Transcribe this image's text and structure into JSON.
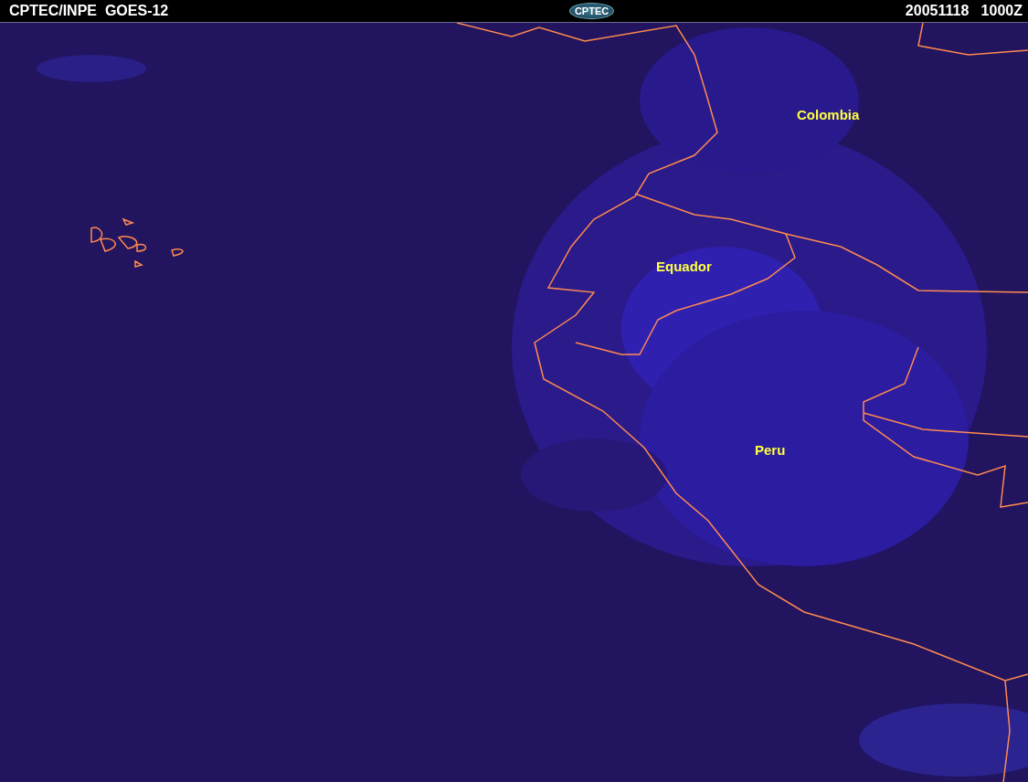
{
  "header": {
    "title": "CPTEC/INPE  GOES-12",
    "logo": "CPTEC",
    "timestamp": "20051118   1000Z"
  },
  "map": {
    "labels": [
      {
        "text": "Colombia"
      },
      {
        "text": "Equador"
      },
      {
        "text": "Peru"
      }
    ]
  }
}
